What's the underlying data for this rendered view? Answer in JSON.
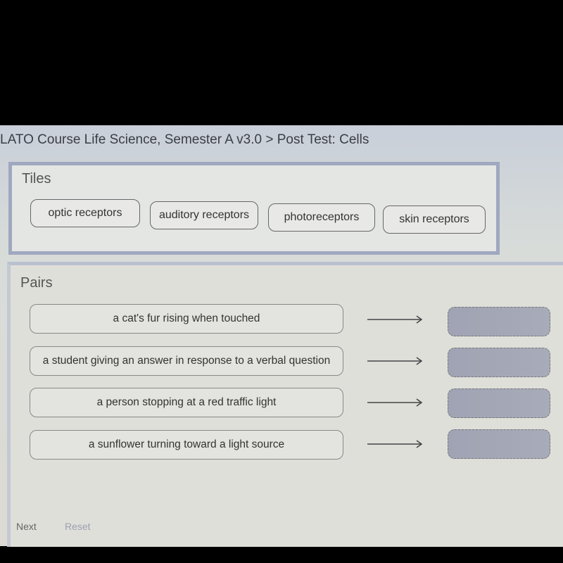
{
  "header": {
    "breadcrumb": "LATO Course Life Science, Semester A v3.0 > Post Test: Cells"
  },
  "tiles": {
    "title": "Tiles",
    "items": [
      "optic receptors",
      "auditory receptors",
      "photoreceptors",
      "skin receptors"
    ]
  },
  "pairs": {
    "title": "Pairs",
    "items": [
      {
        "prompt": "a cat's fur rising when touched",
        "answer": ""
      },
      {
        "prompt": "a student giving an answer in response to a verbal question",
        "answer": ""
      },
      {
        "prompt": "a person stopping at a red traffic light",
        "answer": ""
      },
      {
        "prompt": "a sunflower turning toward a light source",
        "answer": ""
      }
    ],
    "arrow_icon": "right-arrow"
  },
  "footer": {
    "next_label": "Next",
    "reset_label": "Reset"
  }
}
